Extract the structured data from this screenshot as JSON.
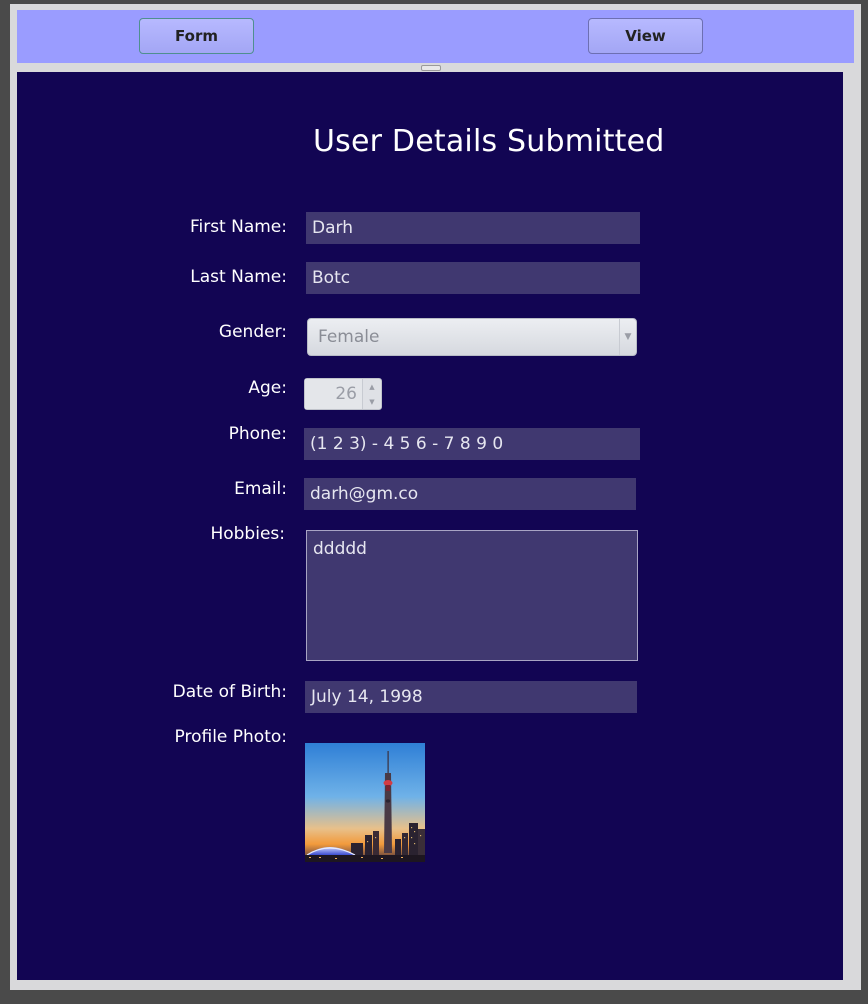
{
  "toolbar": {
    "form_label": "Form",
    "view_label": "View"
  },
  "page": {
    "title": "User Details Submitted"
  },
  "fields": {
    "first_name": {
      "label": "First Name:",
      "value": "Darh"
    },
    "last_name": {
      "label": "Last Name:",
      "value": "Botc"
    },
    "gender": {
      "label": "Gender:",
      "value": "Female"
    },
    "age": {
      "label": "Age:",
      "value": "26"
    },
    "phone": {
      "label": "Phone:",
      "value": "(1 2 3) - 4 5 6 - 7 8 9 0"
    },
    "email": {
      "label": "Email:",
      "value": "darh@gm.co"
    },
    "hobbies": {
      "label": "Hobbies:",
      "value": "ddddd"
    },
    "dob": {
      "label": "Date of Birth:",
      "value": "July 14, 1998"
    },
    "photo": {
      "label": "Profile Photo:"
    }
  },
  "colors": {
    "toolbar_bg": "#9a9cff",
    "content_bg": "#120553",
    "field_bg": "#403870"
  }
}
